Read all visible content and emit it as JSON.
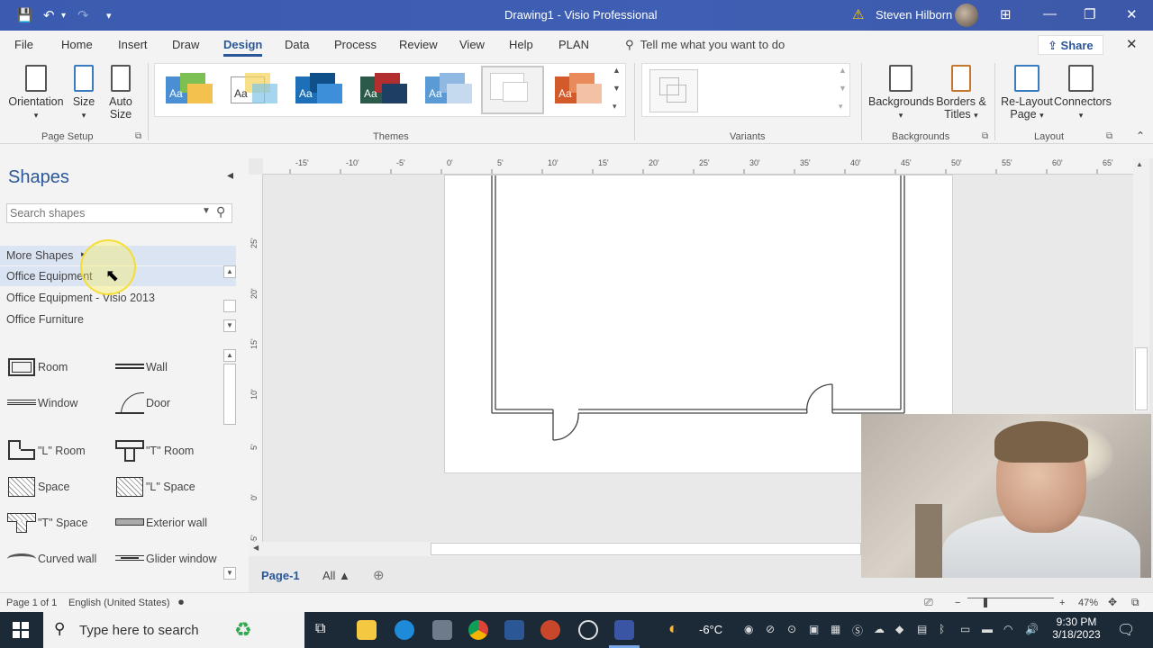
{
  "window": {
    "title": "Drawing1  -  Visio Professional",
    "user": "Steven Hilborn",
    "minimize": "—",
    "restore": "❐",
    "close": "✕",
    "ribbon_display": "⊞"
  },
  "quick_access": {
    "save_icon": "💾",
    "undo_icon": "↶",
    "redo_icon": "↷",
    "customize_icon": "▾"
  },
  "menu": {
    "tabs": [
      "File",
      "Home",
      "Insert",
      "Draw",
      "Design",
      "Data",
      "Process",
      "Review",
      "View",
      "Help",
      "PLAN"
    ],
    "active_tab": "Design",
    "tell_me": "Tell me what you want to do",
    "share": "Share"
  },
  "ribbon": {
    "page_setup": {
      "orientation": "Orientation",
      "size": "Size",
      "auto_size": "Auto Size",
      "label": "Page Setup"
    },
    "themes": {
      "label": "Themes",
      "items": [
        {
          "text": "Aa",
          "a": "#4a8fd4",
          "b": "#7cbf53",
          "c": "#f2c14e"
        },
        {
          "text": "Aa",
          "a": "#ffffff",
          "b": "#f5d35a",
          "c": "#7fc3e8"
        },
        {
          "text": "Aa",
          "a": "#1d6fb8",
          "b": "#0f4f8a",
          "c": "#3c8fd8"
        },
        {
          "text": "Aa",
          "a": "#2b5a4a",
          "b": "#b32f2f",
          "c": "#1e3f63"
        },
        {
          "text": "Aa",
          "a": "#5b9bd5",
          "b": "#8fb8e2",
          "c": "#c5d9ef"
        },
        {
          "text": "",
          "a": "#ffffff",
          "b": "#ffffff",
          "c": "#ffffff"
        },
        {
          "text": "Aa",
          "a": "#d25a2b",
          "b": "#e88a5a",
          "c": "#f3c1a3"
        }
      ]
    },
    "variants": {
      "label": "Variants"
    },
    "backgrounds": {
      "backgrounds": "Backgrounds",
      "borders_titles": "Borders & Titles",
      "label": "Backgrounds"
    },
    "layout": {
      "relayout": "Re-Layout Page",
      "connectors": "Connectors",
      "label": "Layout"
    }
  },
  "shapes_pane": {
    "title": "Shapes",
    "search_placeholder": "Search shapes",
    "stencils": [
      "More Shapes",
      "Office Equipment",
      "Office Equipment - Visio 2013",
      "Office Furniture"
    ],
    "shapes": [
      {
        "label": "Room"
      },
      {
        "label": "Wall"
      },
      {
        "label": "Window"
      },
      {
        "label": "Door"
      },
      {
        "label": "\"L\" Room"
      },
      {
        "label": "\"T\" Room"
      },
      {
        "label": "Space"
      },
      {
        "label": "\"L\" Space"
      },
      {
        "label": "\"T\" Space"
      },
      {
        "label": "Exterior wall"
      },
      {
        "label": "Curved wall"
      },
      {
        "label": "Glider window"
      }
    ]
  },
  "rulers": {
    "h_ticks": [
      "-15'",
      "-10'",
      "-5'",
      "0'",
      "5'",
      "10'",
      "15'",
      "20'",
      "25'",
      "30'",
      "35'",
      "40'",
      "45'",
      "50'",
      "55'",
      "60'",
      "65'"
    ],
    "v_ticks": [
      "25'",
      "20'",
      "15'",
      "10'",
      "5'",
      "0'",
      "-5'"
    ]
  },
  "page_tabs": {
    "current": "Page-1",
    "all": "All ▲",
    "add": "⊕"
  },
  "status": {
    "page": "Page 1 of 1",
    "language": "English (United States)",
    "zoom": "47%"
  },
  "taskbar": {
    "search": "Type here to search",
    "weather": "-6°C",
    "time": "9:30 PM",
    "date": "3/18/2023"
  },
  "colors": {
    "accent": "#2b579a",
    "titlebar": "#3e5fb4",
    "taskbar": "#1c2a38"
  }
}
